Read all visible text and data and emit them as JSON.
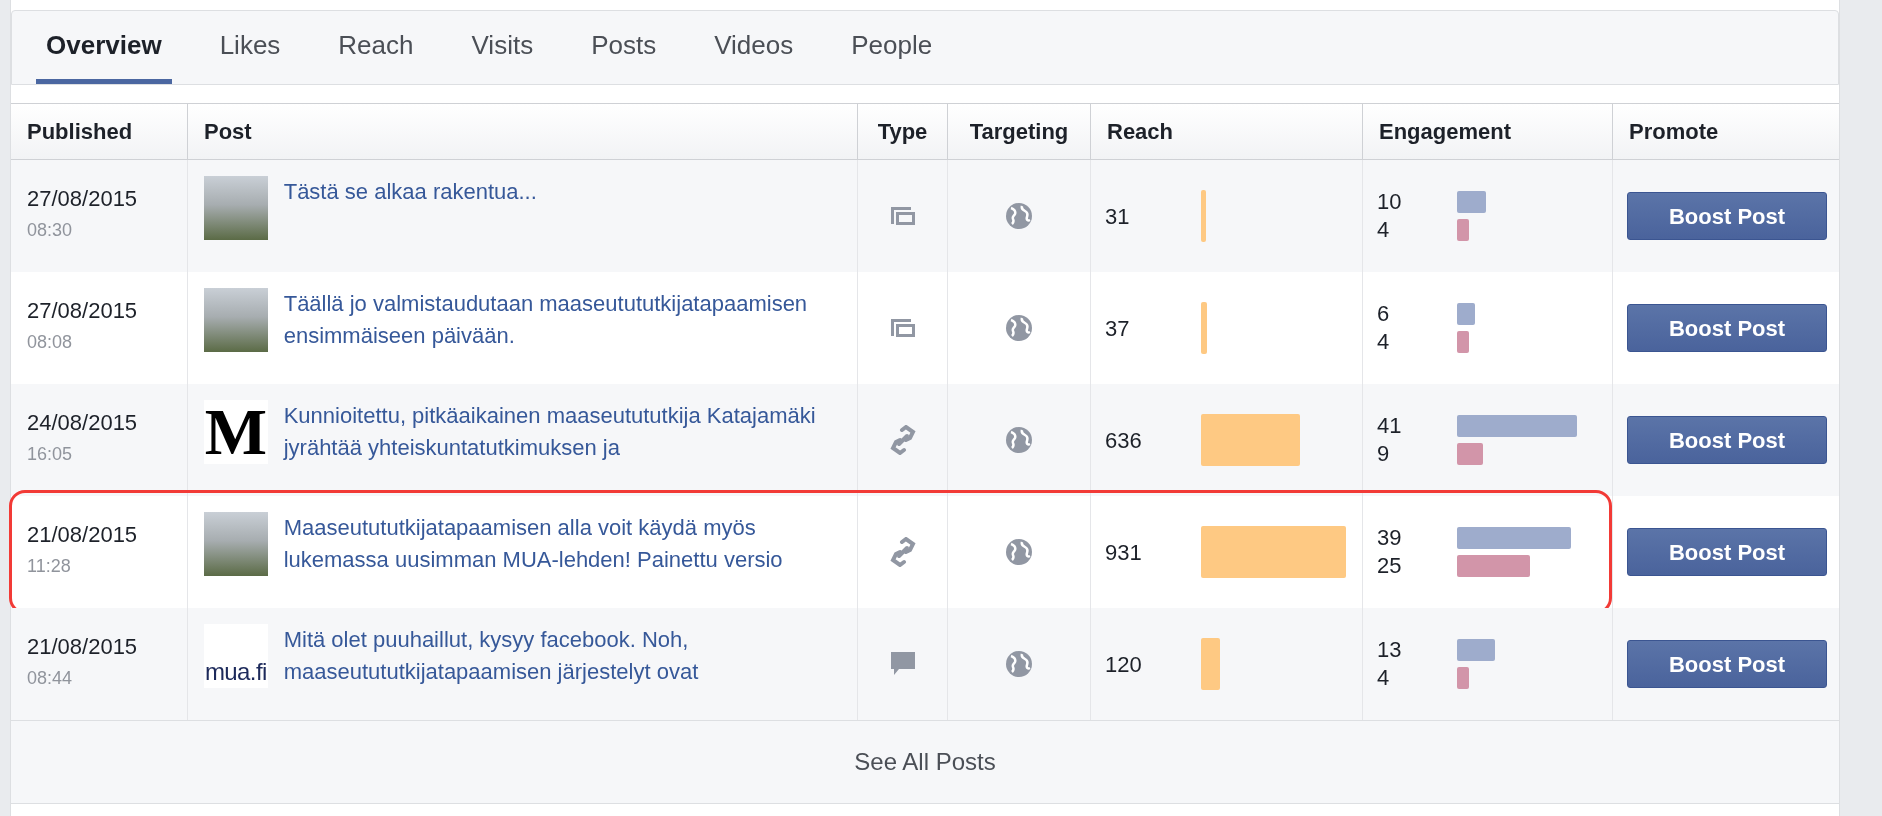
{
  "tabs": [
    {
      "label": "Overview",
      "selected": true
    },
    {
      "label": "Likes",
      "selected": false
    },
    {
      "label": "Reach",
      "selected": false
    },
    {
      "label": "Visits",
      "selected": false
    },
    {
      "label": "Posts",
      "selected": false
    },
    {
      "label": "Videos",
      "selected": false
    },
    {
      "label": "People",
      "selected": false
    }
  ],
  "table": {
    "columns": [
      "Published",
      "Post",
      "Type",
      "Targeting",
      "Reach",
      "Engagement",
      "Promote"
    ],
    "rows": [
      {
        "date": "27/08/2015",
        "time": "08:30",
        "thumbnail": {
          "kind": "photo"
        },
        "text": "Tästä se alkaa rakentua...",
        "type_icon": {
          "kind": "album"
        },
        "targeting_icon": {
          "kind": "public"
        },
        "reach": "31",
        "engagement": [
          {
            "value": "10",
            "color": "#9eaccc"
          },
          {
            "value": "4",
            "color": "#d295a9"
          }
        ],
        "button": "Boost Post",
        "highlighted": false
      },
      {
        "date": "27/08/2015",
        "time": "08:08",
        "thumbnail": {
          "kind": "photo"
        },
        "text": "Täällä jo valmistaudutaan maaseutututkijatapaamisen ensimmäiseen päivään.",
        "type_icon": {
          "kind": "album"
        },
        "targeting_icon": {
          "kind": "public"
        },
        "reach": "37",
        "engagement": [
          {
            "value": "6",
            "color": "#9eaccc"
          },
          {
            "value": "4",
            "color": "#d295a9"
          }
        ],
        "button": "Boost Post",
        "highlighted": false
      },
      {
        "date": "24/08/2015",
        "time": "16:05",
        "thumbnail": {
          "kind": "logo",
          "text": "M"
        },
        "text": "Kunnioitettu, pitkäaikainen maaseutututkija Katajamäki jyrähtää yhteiskuntatutkimuksen ja",
        "type_icon": {
          "kind": "link"
        },
        "targeting_icon": {
          "kind": "public"
        },
        "reach": "636",
        "engagement": [
          {
            "value": "41",
            "color": "#9eaccc"
          },
          {
            "value": "9",
            "color": "#d295a9"
          }
        ],
        "button": "Boost Post",
        "highlighted": false
      },
      {
        "date": "21/08/2015",
        "time": "11:28",
        "thumbnail": {
          "kind": "photo"
        },
        "text": "Maaseutututkijatapaamisen alla voit käydä myös lukemassa uusimman MUA-lehden! Painettu versio",
        "type_icon": {
          "kind": "link"
        },
        "targeting_icon": {
          "kind": "public"
        },
        "reach": "931",
        "engagement": [
          {
            "value": "39",
            "color": "#9eaccc"
          },
          {
            "value": "25",
            "color": "#d295a9"
          }
        ],
        "button": "Boost Post",
        "highlighted": true
      },
      {
        "date": "21/08/2015",
        "time": "08:44",
        "thumbnail": {
          "kind": "wordmark",
          "text": "mua.fi"
        },
        "text": "Mitä olet puuhaillut, kysyy facebook. Noh, maaseutututkijatapaamisen järjestelyt ovat",
        "type_icon": {
          "kind": "status"
        },
        "targeting_icon": {
          "kind": "public"
        },
        "reach": "120",
        "engagement": [
          {
            "value": "13",
            "color": "#9eaccc"
          },
          {
            "value": "4",
            "color": "#d295a9"
          }
        ],
        "button": "Boost Post",
        "highlighted": false
      }
    ]
  },
  "footer": {
    "link": "See All Posts"
  }
}
